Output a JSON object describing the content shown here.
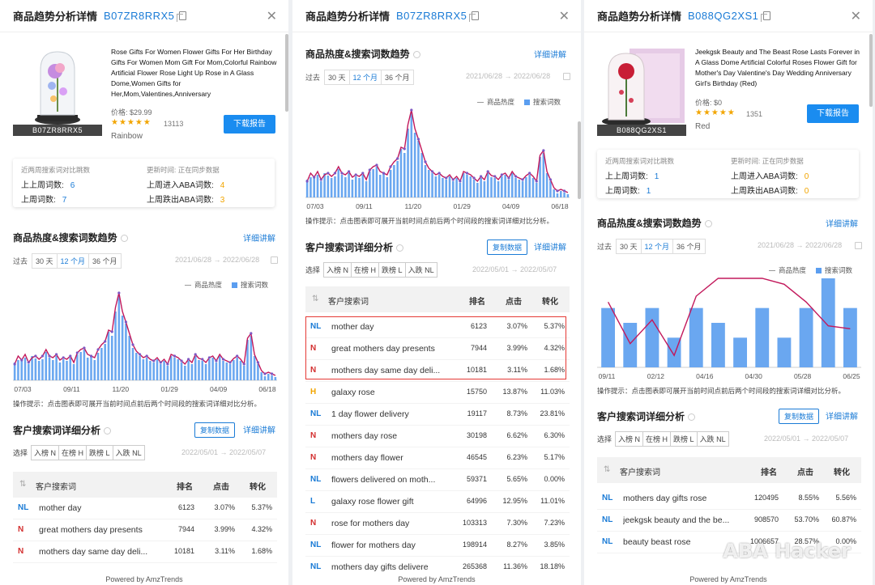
{
  "common": {
    "panel_title": "商品趋势分析详情",
    "download_label": "下载报告",
    "stat_last_week_label": "近两周搜索词对比跳数",
    "stat_update_label": "更新时间: 正在同步数据",
    "prev_prev_week_label": "上上周词数:",
    "prev_week_label": "上周词数:",
    "enter_aba_label": "上周进入ABA词数:",
    "exit_aba_label": "上周跌出ABA词数:",
    "trend_title": "商品热度&搜索词数趋势",
    "detail_link": "详细讲解",
    "range_prefix": "过去",
    "range_options": [
      "30 天",
      "12 个月",
      "36 个月"
    ],
    "range_selected": "12 个月",
    "trend_date_range": "2021/06/28 → 2022/06/28",
    "legend_heat": "商品热度",
    "legend_search": "搜索词数",
    "chart_hint": "操作提示：点击图表即可展开当前时间点前后两个时间段的搜索词详细对比分析。",
    "keyword_title": "客户搜索词详细分析",
    "copy_data": "复制数据",
    "filter_prefix": "选择",
    "filter_options": [
      "入榜 N",
      "在榜 H",
      "跌榜 L",
      "入跌 NL"
    ],
    "kw_date_range": "2022/05/01 → 2022/05/07",
    "col_keyword": "客户搜索词",
    "col_rank": "排名",
    "col_click": "点击",
    "col_conversion": "转化",
    "powered_by": "Powered by AmzTrends",
    "watermark": "ABA Hacker"
  },
  "panels": [
    {
      "asin": "B07ZR8RRX5",
      "product_title": "Rose Gifts For Women Flower Gifts For Her Birthday Gifts For Women Mom Gift For Mom,Colorful Rainbow Artificial Flower Rose Light Up Rose in A Glass Dome,Women Gifts for Her,Mom,Valentines,Anniversary",
      "price": "价格: $29.99",
      "rating": 4.5,
      "stars": "★★★★★",
      "review_count": "13113",
      "variant": "Rainbow",
      "image_label": "B07ZR8RRX5",
      "prev_prev_week": "6",
      "prev_week": "7",
      "enter_aba": "4",
      "exit_aba": "3",
      "x_ticks": [
        "07/03",
        "09/11",
        "11/20",
        "01/29",
        "04/09",
        "06/18"
      ],
      "rows": [
        {
          "tag": "NL",
          "keyword": "mother day",
          "rank": "6123",
          "click": "3.07%",
          "conv": "5.37%"
        },
        {
          "tag": "N",
          "keyword": "great mothers day presents",
          "rank": "7944",
          "click": "3.99%",
          "conv": "4.32%"
        },
        {
          "tag": "N",
          "keyword": "mothers day same day deli...",
          "rank": "10181",
          "click": "3.11%",
          "conv": "1.68%"
        }
      ]
    },
    {
      "asin": "B07ZR8RRX5",
      "x_ticks": [
        "07/03",
        "09/11",
        "11/20",
        "01/29",
        "04/09",
        "06/18"
      ],
      "rows": [
        {
          "tag": "NL",
          "keyword": "mother day",
          "rank": "6123",
          "click": "3.07%",
          "conv": "5.37%"
        },
        {
          "tag": "N",
          "keyword": "great mothers day presents",
          "rank": "7944",
          "click": "3.99%",
          "conv": "4.32%"
        },
        {
          "tag": "N",
          "keyword": "mothers day same day deli...",
          "rank": "10181",
          "click": "3.11%",
          "conv": "1.68%"
        },
        {
          "tag": "H",
          "keyword": "galaxy rose",
          "rank": "15750",
          "click": "13.87%",
          "conv": "11.03%"
        },
        {
          "tag": "NL",
          "keyword": "1 day flower delivery",
          "rank": "19117",
          "click": "8.73%",
          "conv": "23.81%"
        },
        {
          "tag": "N",
          "keyword": "mothers day rose",
          "rank": "30198",
          "click": "6.62%",
          "conv": "6.30%"
        },
        {
          "tag": "N",
          "keyword": "mothers day flower",
          "rank": "46545",
          "click": "6.23%",
          "conv": "5.17%"
        },
        {
          "tag": "NL",
          "keyword": "flowers delivered on moth...",
          "rank": "59371",
          "click": "5.65%",
          "conv": "0.00%"
        },
        {
          "tag": "L",
          "keyword": "galaxy rose flower gift",
          "rank": "64996",
          "click": "12.95%",
          "conv": "11.01%"
        },
        {
          "tag": "N",
          "keyword": "rose for mothers day",
          "rank": "103313",
          "click": "7.30%",
          "conv": "7.23%"
        },
        {
          "tag": "NL",
          "keyword": "flower for mothers day",
          "rank": "198914",
          "click": "8.27%",
          "conv": "3.85%"
        },
        {
          "tag": "NL",
          "keyword": "mothers day gifts delivere",
          "rank": "265368",
          "click": "11.36%",
          "conv": "18.18%"
        }
      ]
    },
    {
      "asin": "B088QG2XS1",
      "product_title": "Jeekgsk Beauty and The Beast Rose Lasts Forever in A Glass Dome Artificial Colorful Roses Flower Gift for Mother's Day Valentine's Day Wedding Anniversary Girl's Birthday (Red)",
      "price": "价格: $0",
      "rating": 4.5,
      "stars": "★★★★★",
      "review_count": "1351",
      "variant": "Red",
      "image_label": "B088QG2XS1",
      "prev_prev_week": "1",
      "prev_week": "1",
      "enter_aba": "0",
      "exit_aba": "0",
      "x_ticks": [
        "09/11",
        "02/12",
        "04/16",
        "04/30",
        "05/28",
        "06/25"
      ],
      "rows": [
        {
          "tag": "NL",
          "keyword": "mothers day gifts rose",
          "rank": "120495",
          "click": "8.55%",
          "conv": "5.56%"
        },
        {
          "tag": "NL",
          "keyword": "jeekgsk beauty and the be...",
          "rank": "908570",
          "click": "53.70%",
          "conv": "60.87%"
        },
        {
          "tag": "NL",
          "keyword": "beauty beast rose",
          "rank": "1006657",
          "click": "28.57%",
          "conv": "0.00%"
        }
      ]
    }
  ],
  "chart_data": [
    {
      "type": "bar",
      "title": "商品热度&搜索词数趋势",
      "series": [
        {
          "name": "搜索词数",
          "values": [
            22,
            25,
            24,
            28,
            20,
            30,
            27,
            24,
            26,
            35,
            28,
            25,
            30,
            22,
            26,
            24,
            28,
            20,
            32,
            35,
            38,
            28,
            30,
            25,
            34,
            40,
            45,
            60,
            55,
            85,
            105,
            80,
            70,
            55,
            40,
            34,
            30,
            26,
            28,
            24,
            22,
            26,
            20,
            24,
            18,
            30,
            28,
            26,
            22,
            18,
            24,
            20,
            30,
            25,
            24,
            20,
            26,
            28,
            22,
            30,
            24,
            22,
            20,
            25,
            28,
            24,
            18,
            50,
            55,
            30,
            20,
            10,
            5,
            8,
            6,
            4
          ]
        },
        {
          "name": "商品热度",
          "values": [
            20,
            30,
            25,
            32,
            22,
            28,
            30,
            26,
            30,
            38,
            30,
            28,
            32,
            25,
            28,
            26,
            30,
            22,
            34,
            38,
            40,
            32,
            30,
            28,
            38,
            44,
            48,
            62,
            60,
            90,
            108,
            85,
            72,
            58,
            44,
            36,
            32,
            28,
            30,
            26,
            24,
            28,
            22,
            26,
            20,
            32,
            30,
            28,
            24,
            20,
            26,
            22,
            32,
            27,
            26,
            22,
            28,
            30,
            24,
            32,
            26,
            24,
            22,
            27,
            30,
            26,
            20,
            52,
            58,
            32,
            22,
            12,
            8,
            10,
            8,
            6
          ]
        }
      ],
      "x_ticks": [
        "07/03",
        "09/11",
        "11/20",
        "01/29",
        "04/09",
        "06/18"
      ],
      "legend": "top-right",
      "grid": false
    },
    {
      "type": "bar",
      "title": "商品热度&搜索词数趋势",
      "series": [
        {
          "name": "搜索词数",
          "values": [
            2,
            1.5,
            2,
            1,
            2,
            1.5,
            1,
            2,
            1,
            2,
            3,
            2
          ]
        },
        {
          "name": "商品热度",
          "values": [
            2.2,
            0.8,
            1.6,
            0.4,
            2.4,
            3,
            3,
            3,
            2.8,
            2.2,
            1.4,
            1.3
          ]
        }
      ],
      "x_ticks": [
        "09/11",
        "02/12",
        "04/16",
        "04/30",
        "05/28",
        "06/25"
      ],
      "legend": "top-right",
      "grid": false
    }
  ]
}
